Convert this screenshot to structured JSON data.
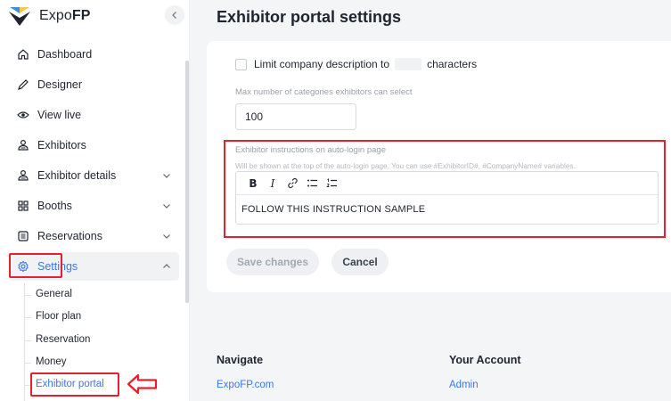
{
  "brand": {
    "name_light": "Expo",
    "name_bold": "FP"
  },
  "sidebar": {
    "items": [
      {
        "label": "Dashboard",
        "icon": "home-icon"
      },
      {
        "label": "Designer",
        "icon": "pencil-icon"
      },
      {
        "label": "View live",
        "icon": "eye-icon"
      },
      {
        "label": "Exhibitors",
        "icon": "users-icon"
      },
      {
        "label": "Exhibitor details",
        "icon": "users-icon",
        "expandable": true
      },
      {
        "label": "Booths",
        "icon": "grid-icon",
        "expandable": true
      },
      {
        "label": "Reservations",
        "icon": "list-icon",
        "expandable": true
      },
      {
        "label": "Settings",
        "icon": "gear-icon",
        "expandable": true,
        "expanded": true,
        "active": true
      }
    ],
    "settings_sub": [
      {
        "label": "General"
      },
      {
        "label": "Floor plan"
      },
      {
        "label": "Reservation"
      },
      {
        "label": "Money"
      },
      {
        "label": "Exhibitor portal",
        "active": true
      }
    ]
  },
  "main": {
    "title": "Exhibitor portal settings",
    "limit_description": {
      "label_before": "Limit company description to",
      "label_after": "characters",
      "value": ""
    },
    "max_categories": {
      "label": "Max number of categories exhibitors can select",
      "value": "100"
    },
    "instructions": {
      "label": "Exhibitor instructions on auto-login page",
      "hint": "Will be shown at the top of the auto-login page. You can use #ExhibitorID#, #CompanyName# variables.",
      "toolbar": {
        "bold": "B",
        "italic": "I"
      },
      "content": "FOLLOW THIS INSTRUCTION SAMPLE"
    },
    "buttons": {
      "save": "Save changes",
      "cancel": "Cancel"
    }
  },
  "footer": {
    "navigate": {
      "title": "Navigate",
      "links": [
        "ExpoFP.com"
      ]
    },
    "account": {
      "title": "Your Account",
      "links": [
        "Admin"
      ]
    }
  },
  "colors": {
    "accent": "#3b78e7",
    "highlight": "#e0232e"
  }
}
